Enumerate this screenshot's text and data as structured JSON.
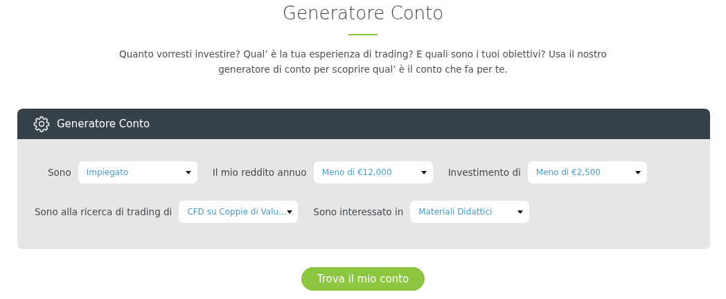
{
  "heading": "Generatore Conto",
  "intro": "Quanto vorresti investire? Qual’ è la tua esperienza di trading? E quali sono i tuoi obiettivi? Usa il nostro generatore di conto per scoprire qual’ è il conto che fa per te.",
  "panel": {
    "title": "Generatore Conto",
    "rows": [
      [
        {
          "label": "Sono",
          "value": "Impiegato"
        },
        {
          "label": "Il mio reddito annuo",
          "value": "Meno di €12,000"
        },
        {
          "label": "Investimento di",
          "value": "Meno di €2,500"
        }
      ],
      [
        {
          "label": "Sono alla ricerca di trading di",
          "value": "CFD su Coppie di Valu..."
        },
        {
          "label": "Sono interessato in",
          "value": "Materiali Didattici"
        }
      ]
    ]
  },
  "button": "Trova il mio conto"
}
